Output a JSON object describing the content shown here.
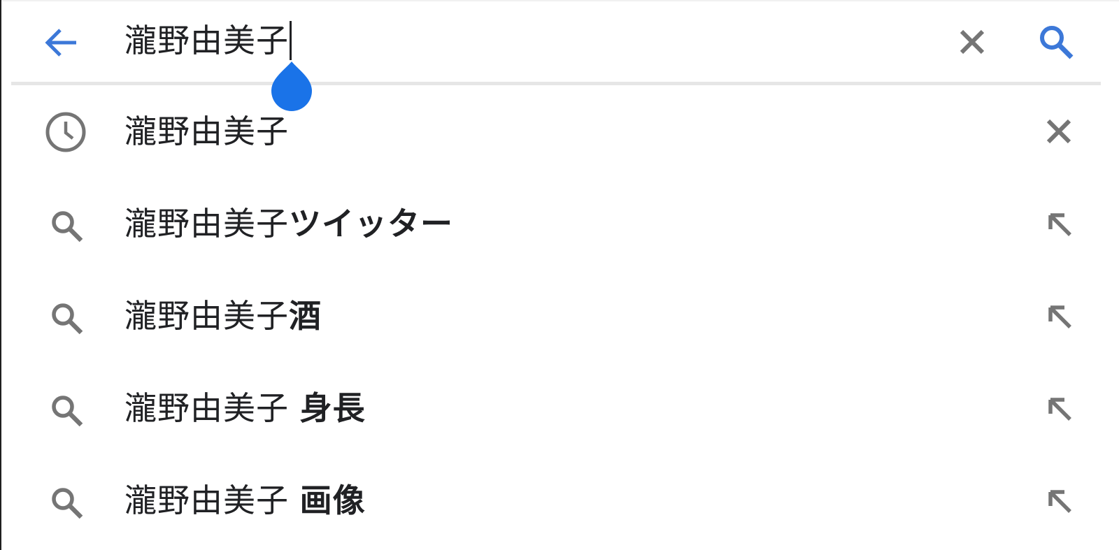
{
  "colors": {
    "accent": "#3c78d8",
    "handle": "#1a73e8",
    "icon_gray": "#757575",
    "text": "#202124",
    "divider": "#e6e6e6"
  },
  "search_bar": {
    "back_icon": "arrow-left-icon",
    "query": "瀧野由美子",
    "clear_icon": "close-icon",
    "search_icon": "search-icon"
  },
  "suggestions": [
    {
      "type": "history",
      "icon": "history-clock-icon",
      "prefix": "瀧野由美子",
      "suffix": "",
      "action_icon": "close-icon"
    },
    {
      "type": "search",
      "icon": "search-icon",
      "prefix": "瀧野由美子",
      "suffix": "ツイッター",
      "action_icon": "arrow-up-left-icon"
    },
    {
      "type": "search",
      "icon": "search-icon",
      "prefix": "瀧野由美子",
      "suffix": "酒",
      "action_icon": "arrow-up-left-icon"
    },
    {
      "type": "search",
      "icon": "search-icon",
      "prefix": "瀧野由美子 ",
      "suffix": "身長",
      "action_icon": "arrow-up-left-icon"
    },
    {
      "type": "search",
      "icon": "search-icon",
      "prefix": "瀧野由美子 ",
      "suffix": "画像",
      "action_icon": "arrow-up-left-icon"
    }
  ]
}
